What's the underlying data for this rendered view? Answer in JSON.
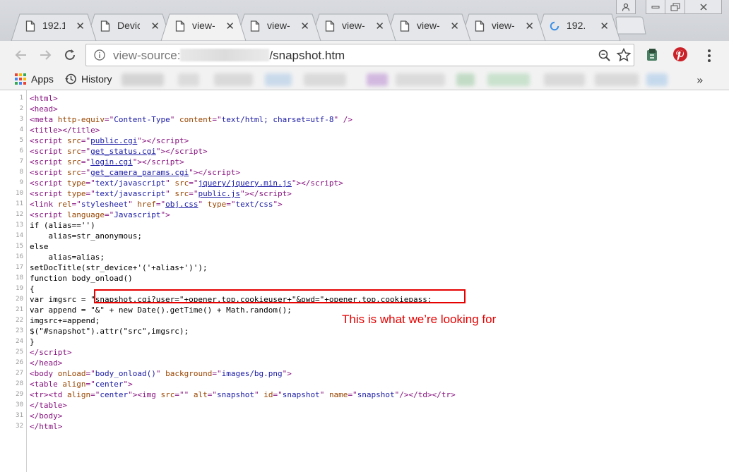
{
  "window": {
    "controls": [
      "account",
      "minimize",
      "maximize",
      "close"
    ]
  },
  "tabs": [
    {
      "label": "192.1",
      "icon": "page-icon"
    },
    {
      "label": "Devic",
      "icon": "page-icon"
    },
    {
      "label": "view-",
      "icon": "page-icon",
      "active": true
    },
    {
      "label": "view-",
      "icon": "page-icon"
    },
    {
      "label": "view-",
      "icon": "page-icon"
    },
    {
      "label": "view-",
      "icon": "page-icon"
    },
    {
      "label": "view-",
      "icon": "page-icon"
    },
    {
      "label": "192.",
      "icon": "loading-icon"
    }
  ],
  "toolbar": {
    "url_scheme": "view-source:",
    "url_path": "/snapshot.htm"
  },
  "bookmarks": {
    "apps_label": "Apps",
    "history_label": "History",
    "overflow": "»"
  },
  "source": {
    "lines": [
      {
        "n": "1",
        "html": "<span class=\"tag\">&lt;html&gt;</span>"
      },
      {
        "n": "2",
        "html": "<span class=\"tag\">&lt;head&gt;</span>"
      },
      {
        "n": "3",
        "html": "<span class=\"tag\">&lt;meta <span class=\"attr\">http-equiv</span>=\"<span class=\"val\">Content-Type</span>\" <span class=\"attr\">content</span>=\"<span class=\"val\">text/html; charset=utf-8</span>\" /&gt;</span>"
      },
      {
        "n": "4",
        "html": "<span class=\"tag\">&lt;title&gt;&lt;/title&gt;</span>"
      },
      {
        "n": "5",
        "html": "<span class=\"tag\">&lt;script <span class=\"attr\">src</span>=\"<span class=\"link\">public.cgi</span>\"&gt;&lt;/script&gt;</span>"
      },
      {
        "n": "6",
        "html": "<span class=\"tag\">&lt;script <span class=\"attr\">src</span>=\"<span class=\"link\">get_status.cgi</span>\"&gt;&lt;/script&gt;</span>"
      },
      {
        "n": "7",
        "html": "<span class=\"tag\">&lt;script <span class=\"attr\">src</span>=\"<span class=\"link\">login.cgi</span>\"&gt;&lt;/script&gt;</span>"
      },
      {
        "n": "8",
        "html": "<span class=\"tag\">&lt;script <span class=\"attr\">src</span>=\"<span class=\"link\">get_camera_params.cgi</span>\"&gt;&lt;/script&gt;</span>"
      },
      {
        "n": "9",
        "html": "<span class=\"tag\">&lt;script <span class=\"attr\">type</span>=\"<span class=\"val\">text/javascript</span>\" <span class=\"attr\">src</span>=\"<span class=\"link\">jquery/jquery.min.js</span>\"&gt;&lt;/script&gt;</span>"
      },
      {
        "n": "10",
        "html": "<span class=\"tag\">&lt;script <span class=\"attr\">type</span>=\"<span class=\"val\">text/javascript</span>\" <span class=\"attr\">src</span>=\"<span class=\"link\">public.js</span>\"&gt;&lt;/script&gt;</span>"
      },
      {
        "n": "11",
        "html": "<span class=\"tag\">&lt;link <span class=\"attr\">rel</span>=\"<span class=\"val\">stylesheet</span>\" <span class=\"attr\">href</span>=\"<span class=\"link\">obj.css</span>\" <span class=\"attr\">type</span>=\"<span class=\"val\">text/css</span>\"&gt;</span>"
      },
      {
        "n": "12",
        "html": "<span class=\"tag\">&lt;script <span class=\"attr\">language</span>=\"<span class=\"val\">Javascript</span>\"&gt;</span>"
      },
      {
        "n": "13",
        "html": "if (alias=='')"
      },
      {
        "n": "14",
        "html": "    alias=str_anonymous;"
      },
      {
        "n": "15",
        "html": "else"
      },
      {
        "n": "16",
        "html": "    alias=alias;"
      },
      {
        "n": "17",
        "html": "setDocTitle(str_device+'('+alias+')');"
      },
      {
        "n": "18",
        "html": "function body_onload()"
      },
      {
        "n": "19",
        "html": "{"
      },
      {
        "n": "20",
        "html": "var imgsrc = \"snapshot.cgi?user=\"+opener.top.cookieuser+\"&amp;pwd=\"+opener.top.cookiepass;"
      },
      {
        "n": "21",
        "html": "var append = \"&amp;\" + new Date().getTime() + Math.random();"
      },
      {
        "n": "22",
        "html": "imgsrc+=append;"
      },
      {
        "n": "23",
        "html": "$(\"#snapshot\").attr(\"src\",imgsrc);"
      },
      {
        "n": "24",
        "html": "}"
      },
      {
        "n": "25",
        "html": "<span class=\"tag\">&lt;/script&gt;</span>"
      },
      {
        "n": "26",
        "html": "<span class=\"tag\">&lt;/head&gt;</span>"
      },
      {
        "n": "27",
        "html": "<span class=\"tag\">&lt;body <span class=\"attr\">onLoad</span>=\"<span class=\"val\">body_onload()</span>\" <span class=\"attr\">background</span>=\"<span class=\"val\">images/bg.png</span>\"&gt;</span>"
      },
      {
        "n": "28",
        "html": "<span class=\"tag\">&lt;table <span class=\"attr\">align</span>=\"<span class=\"val\">center</span>\"&gt;</span>"
      },
      {
        "n": "29",
        "html": "<span class=\"tag\">&lt;tr&gt;&lt;td <span class=\"attr\">align</span>=\"<span class=\"val\">center</span>\"&gt;&lt;img <span class=\"attr\">src</span>=\"\" <span class=\"attr\">alt</span>=\"<span class=\"val\">snapshot</span>\" <span class=\"attr\">id</span>=\"<span class=\"val\">snapshot</span>\" <span class=\"attr\">name</span>=\"<span class=\"val\">snapshot</span>\"/&gt;&lt;/td&gt;&lt;/tr&gt;</span>"
      },
      {
        "n": "30",
        "html": "<span class=\"tag\">&lt;/table&gt;</span>"
      },
      {
        "n": "31",
        "html": "<span class=\"tag\">&lt;/body&gt;</span>"
      },
      {
        "n": "32",
        "html": "<span class=\"tag\">&lt;/html&gt;</span>"
      }
    ]
  },
  "annotation": {
    "text": "This is what we’re looking for",
    "color": "#e60000"
  },
  "colors": {
    "tag": "#881280",
    "attr": "#994500",
    "value": "#1a1aa6",
    "highlight": "#e60000"
  }
}
